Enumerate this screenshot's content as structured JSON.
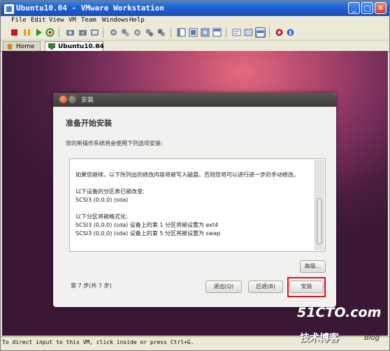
{
  "window": {
    "title": "Ubuntu10.04 - VMware Workstation"
  },
  "menu": [
    "File",
    "Edit",
    "View",
    "VM",
    "Team",
    "Windows",
    "Help"
  ],
  "tabs": [
    {
      "label": "Home"
    },
    {
      "label": "Ubuntu10.04"
    }
  ],
  "dialog": {
    "title": "安装",
    "heading": "准备开始安装",
    "subtitle": "您的新操作系统将会使用下列选项安装:",
    "content": {
      "intro": "如果您继续，以下所列出的修改内容将被写入磁盘。否则您将可以进行进一步的手动修改。",
      "partition_header": "以下设备的分区表已被改变:",
      "partition_line": "SCSI3 (0,0,0) (sda)",
      "format_header": "以下分区将被格式化:",
      "format_line1": "SCSI3 (0,0,0) (sda) 设备上的第 1 分区将被设置为 ext4",
      "format_line2": "SCSI3 (0,0,0) (sda) 设备上的第 5 分区将被设置为 swap"
    },
    "advanced_button": "高级...",
    "step": "第 7 步(共 7 步)",
    "quit_button": "退出(Q)",
    "back_button": "后退(B)",
    "install_button": "安装"
  },
  "status_bar": "To direct input to this VM, click inside or press Ctrl+G.",
  "watermark": {
    "site": "51CTO.com",
    "label": "技术博客",
    "blog": "Blog"
  },
  "colors": {
    "title_bar": "#1f5fd0",
    "highlight": "#d8141e",
    "desktop": "#7a2f5d"
  }
}
